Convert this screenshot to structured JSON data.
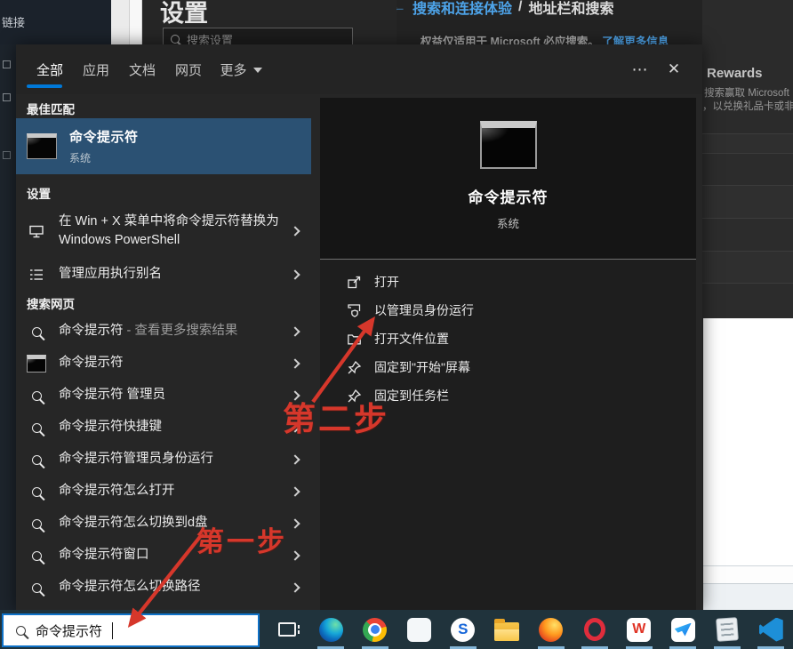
{
  "glyphs": {
    "back": "←",
    "ellipsis": "⋯",
    "close": "✕",
    "breadcrumb_sep": "/"
  },
  "colors": {
    "accent": "#0078d7",
    "annotation_red": "#d6372b",
    "best_match_highlight": "#2b5173",
    "taskbar_search_border": "#0f72c8"
  },
  "background": {
    "left_nav_text": "链接",
    "settings": {
      "title": "设置",
      "search_placeholder": "搜索设置"
    },
    "edge_page": {
      "breadcrumb_primary": "搜索和连接体验",
      "breadcrumb_secondary": "地址栏和搜索",
      "notice": "权益仅适用于 Microsoft 必应搜索。",
      "notice_link": "了解更多信息"
    },
    "rewards": {
      "title": "Rewards",
      "line1": "搜索赢取 Microsoft",
      "line2": "，以兑换礼品卡或非营"
    }
  },
  "search_panel": {
    "tabs": [
      {
        "label": "全部",
        "active": true
      },
      {
        "label": "应用",
        "active": false
      },
      {
        "label": "文档",
        "active": false
      },
      {
        "label": "网页",
        "active": false
      },
      {
        "label": "更多",
        "active": false,
        "has_dropdown": true
      }
    ],
    "sections": {
      "best_match_label": "最佳匹配",
      "best_match": {
        "title": "命令提示符",
        "subtitle": "系统"
      },
      "settings_label": "设置",
      "settings_items": [
        {
          "text": "在 Win + X 菜单中将命令提示符替换为 Windows PowerShell",
          "icon": "monitor"
        },
        {
          "text": "管理应用执行别名",
          "icon": "list"
        }
      ],
      "web_label": "搜索网页",
      "web_items": [
        {
          "text": "命令提示符",
          "suffix": " - 查看更多搜索结果",
          "icon": "search"
        },
        {
          "text": "命令提示符",
          "suffix": "",
          "icon": "cmd"
        },
        {
          "text": "命令提示符 管理员",
          "suffix": "",
          "icon": "search"
        },
        {
          "text": "命令提示符快捷键",
          "suffix": "",
          "icon": "search"
        },
        {
          "text": "命令提示符管理员身份运行",
          "suffix": "",
          "icon": "search"
        },
        {
          "text": "命令提示符怎么打开",
          "suffix": "",
          "icon": "search"
        },
        {
          "text": "命令提示符怎么切换到d盘",
          "suffix": "",
          "icon": "search"
        },
        {
          "text": "命令提示符窗口",
          "suffix": "",
          "icon": "search"
        },
        {
          "text": "命令提示符怎么切换路径",
          "suffix": "",
          "icon": "search"
        }
      ]
    },
    "detail": {
      "title": "命令提示符",
      "subtitle": "系统",
      "actions": [
        {
          "label": "打开",
          "icon": "launch"
        },
        {
          "label": "以管理员身份运行",
          "icon": "shield"
        },
        {
          "label": "打开文件位置",
          "icon": "folder"
        },
        {
          "label": "固定到\"开始\"屏幕",
          "icon": "pin"
        },
        {
          "label": "固定到任务栏",
          "icon": "pin"
        }
      ]
    }
  },
  "annotations": {
    "step1_label": "第一步",
    "step2_label": "第二步"
  },
  "taskbar": {
    "search_value": "命令提示符",
    "icons": [
      {
        "name": "task-view-icon",
        "type": "taskview",
        "glyph": "",
        "running": false
      },
      {
        "name": "edge-icon",
        "type": "edge",
        "glyph": "",
        "running": true
      },
      {
        "name": "chrome-icon",
        "type": "chrome",
        "glyph": "",
        "running": true
      },
      {
        "name": "microsoft-store-icon",
        "type": "store",
        "glyph": "",
        "running": false
      },
      {
        "name": "sogou-browser-icon",
        "type": "sogou",
        "glyph": "S",
        "running": true
      },
      {
        "name": "file-explorer-icon",
        "type": "folder",
        "glyph": "",
        "running": false
      },
      {
        "name": "firefox-icon",
        "type": "firefox",
        "glyph": "",
        "running": true
      },
      {
        "name": "opera-icon",
        "type": "opera",
        "glyph": "",
        "running": true
      },
      {
        "name": "wps-office-icon",
        "type": "wps",
        "glyph": "W",
        "running": true
      },
      {
        "name": "tim-icon",
        "type": "tim",
        "glyph": "",
        "running": true
      },
      {
        "name": "notepad-icon",
        "type": "notepad",
        "glyph": "",
        "running": true
      },
      {
        "name": "vscode-icon",
        "type": "vscode",
        "glyph": "",
        "running": true
      }
    ]
  }
}
